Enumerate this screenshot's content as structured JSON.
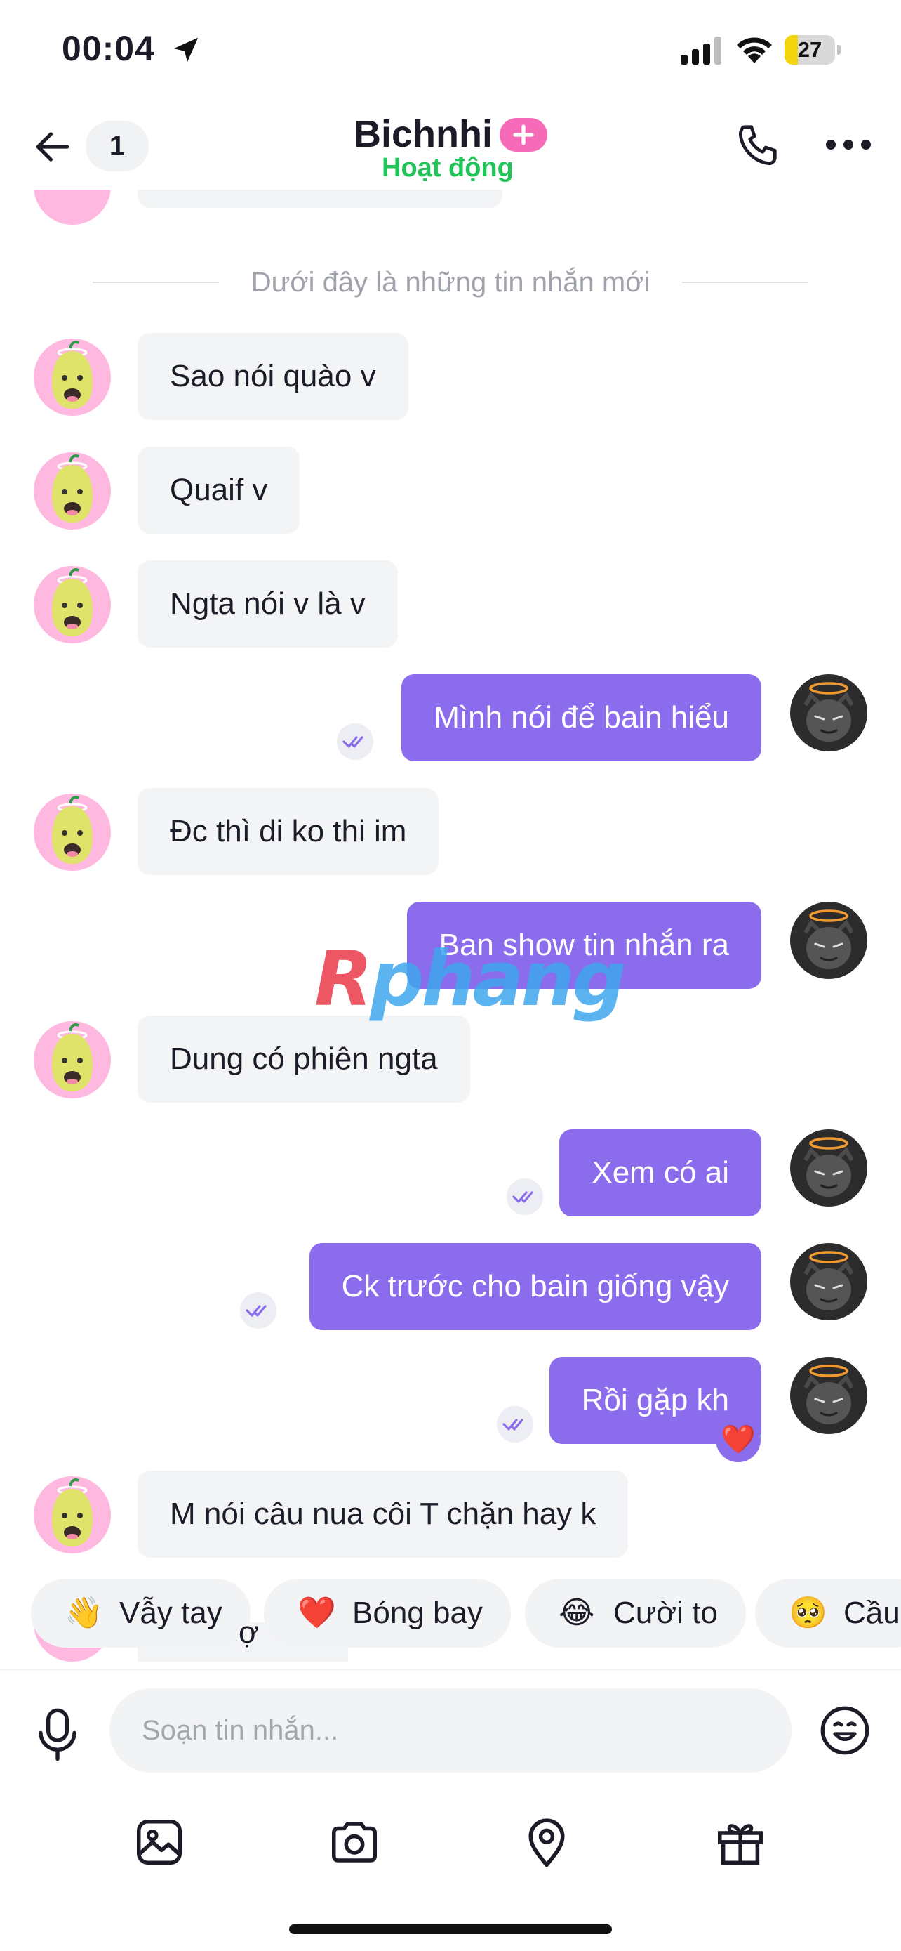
{
  "status_bar": {
    "time": "00:04",
    "battery": "27",
    "battery_level_percent": 27
  },
  "header": {
    "unread_count": "1",
    "contact_name": "Bichnhi",
    "contact_status": "Hoạt động"
  },
  "divider_text": "Dưới đây là những tin nhắn mới",
  "messages": [
    {
      "side": "in",
      "text": "Sao nói quào v"
    },
    {
      "side": "in",
      "text": "Quaif v"
    },
    {
      "side": "in",
      "text": "Ngta nói v là v"
    },
    {
      "side": "out",
      "text": "Mình nói để bain hiểu",
      "read": true
    },
    {
      "side": "in",
      "text": "Đc thì di ko thi im"
    },
    {
      "side": "out",
      "text": "Ban show tin nhắn ra",
      "read": true
    },
    {
      "side": "in",
      "text": "Dung có phiên ngta"
    },
    {
      "side": "out",
      "text": "Xem có ai",
      "read": true
    },
    {
      "side": "out",
      "text": "Ck trước cho bain giống vậy",
      "read": true
    },
    {
      "side": "out",
      "text": "Rồi gặp kh",
      "read": true,
      "reaction": "❤️"
    },
    {
      "side": "in",
      "text": "M nói câu nua côi T chặn hay k"
    }
  ],
  "partial_message_text": "ợ",
  "watermark": {
    "first": "R",
    "rest": "phang"
  },
  "quick_reactions": [
    {
      "emoji": "👋",
      "label": "Vẫy tay"
    },
    {
      "emoji": "❤️",
      "label": "Bóng bay"
    },
    {
      "emoji": "😂",
      "label": "Cười to"
    },
    {
      "emoji": "🥺",
      "label": "Cầu"
    }
  ],
  "composer": {
    "placeholder": "Soạn tin nhắn..."
  },
  "colors": {
    "outgoing_bubble": "#8b6cec",
    "incoming_bubble": "#f3f4f6",
    "online_status": "#22c45a",
    "badge": "#f66bb8"
  },
  "icons": [
    "location-arrow-icon",
    "signal-icon",
    "wifi-icon",
    "back-arrow-icon",
    "plus-icon",
    "phone-icon",
    "more-icon",
    "read-receipt-icon",
    "microphone-icon",
    "emoji-icon",
    "gallery-icon",
    "camera-icon",
    "location-pin-icon",
    "gift-icon"
  ]
}
